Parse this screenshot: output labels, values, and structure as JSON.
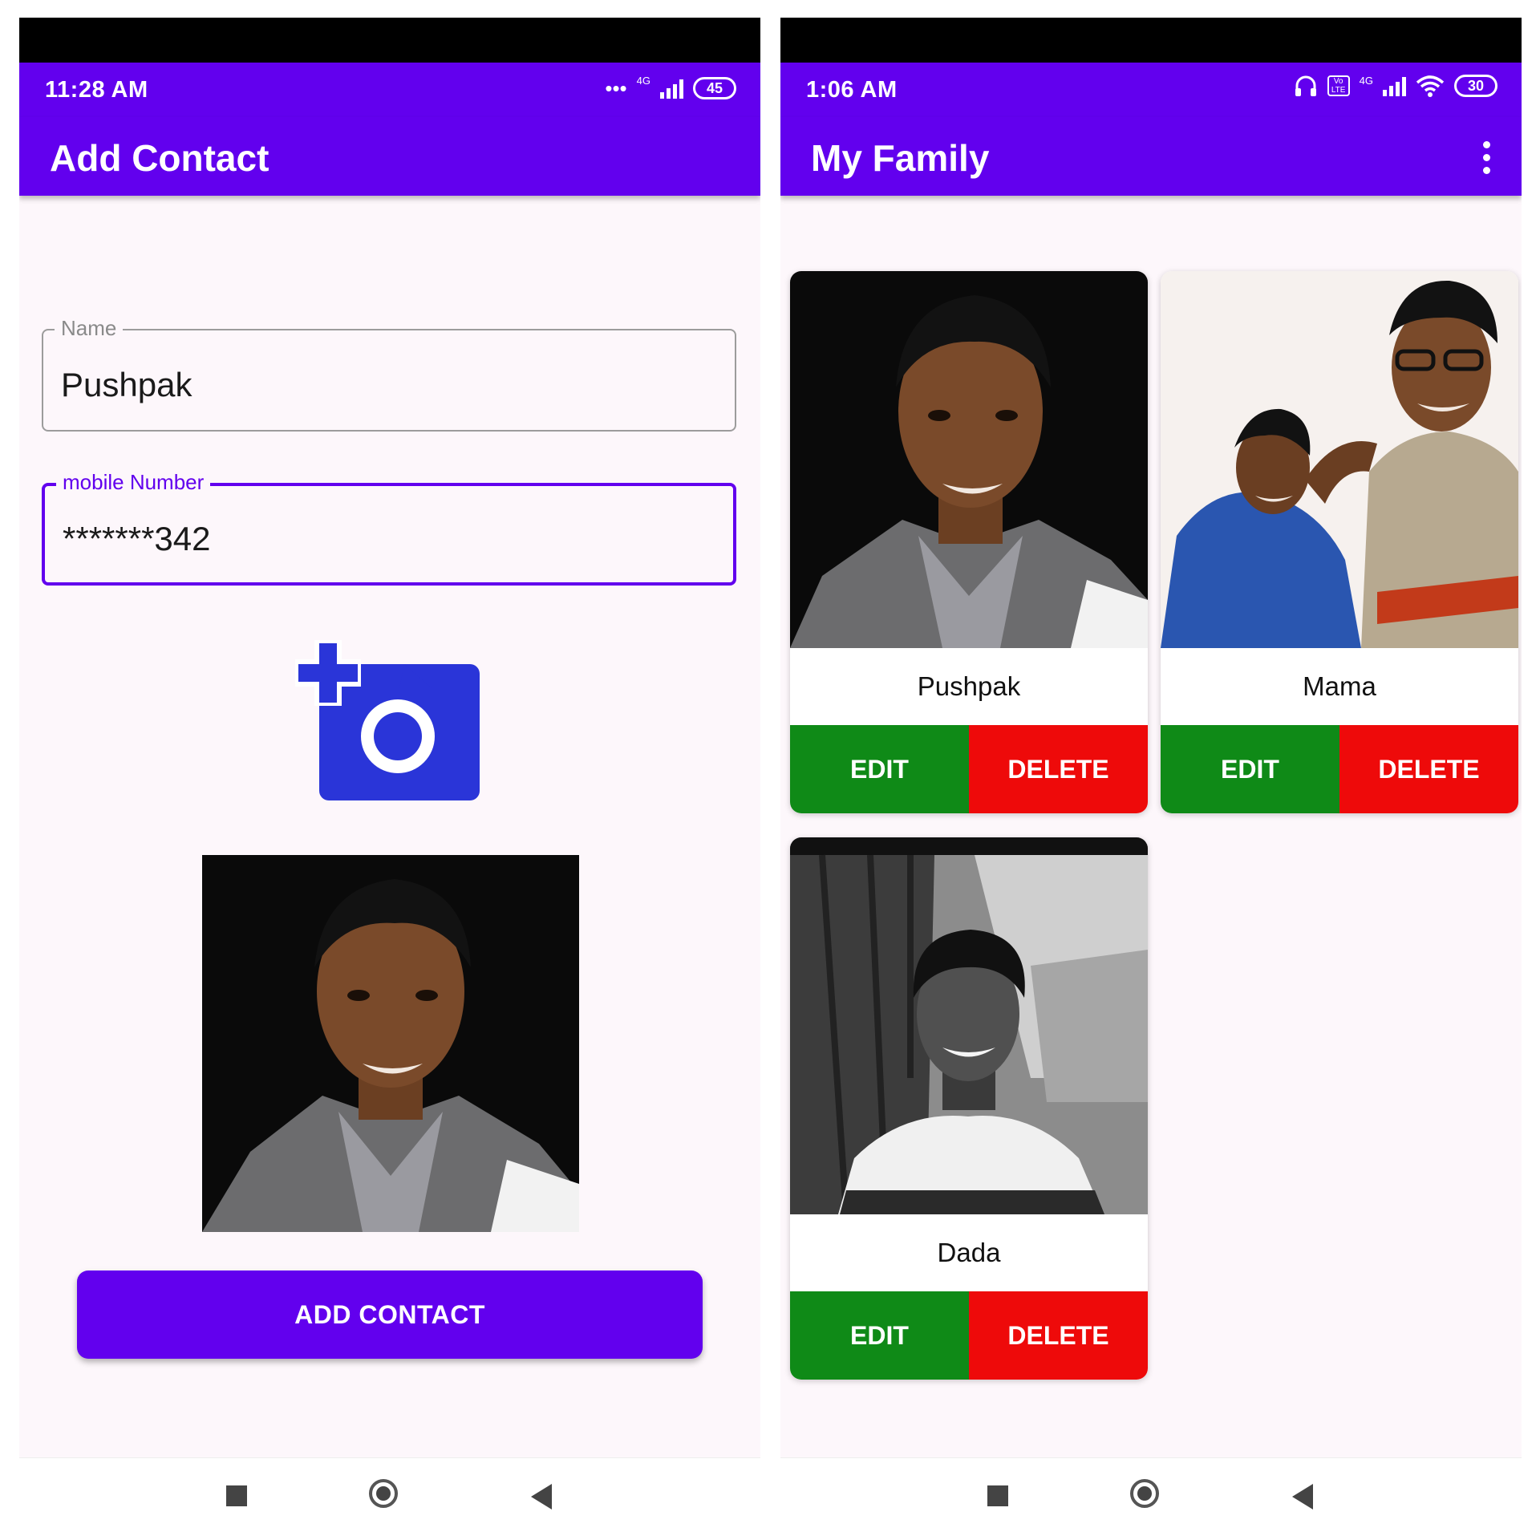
{
  "left_screen": {
    "status_bar": {
      "time": "11:28 AM",
      "more_indicator": "•••",
      "network": "4G",
      "battery": "45"
    },
    "app_bar": {
      "title": "Add Contact"
    },
    "form": {
      "name": {
        "label": "Name",
        "value": "Pushpak"
      },
      "mobile": {
        "label": "mobile Number",
        "value": "*******342"
      }
    },
    "add_photo_icon": "add-photo-camera-icon",
    "submit_label": "ADD CONTACT"
  },
  "right_screen": {
    "status_bar": {
      "time": "1:06 AM",
      "volte": "Vo LTE",
      "network": "4G",
      "battery": "30"
    },
    "app_bar": {
      "title": "My Family",
      "menu_icon": "more-vert-icon"
    },
    "contacts": [
      {
        "name": "Pushpak",
        "edit_label": "EDIT",
        "delete_label": "DELETE"
      },
      {
        "name": "Mama",
        "edit_label": "EDIT",
        "delete_label": "DELETE"
      },
      {
        "name": "Dada",
        "edit_label": "EDIT",
        "delete_label": "DELETE"
      }
    ]
  },
  "colors": {
    "primary": "#6200ee",
    "edit": "#0f8a17",
    "delete": "#ee0a0a",
    "camera_icon": "#2a35d8"
  }
}
